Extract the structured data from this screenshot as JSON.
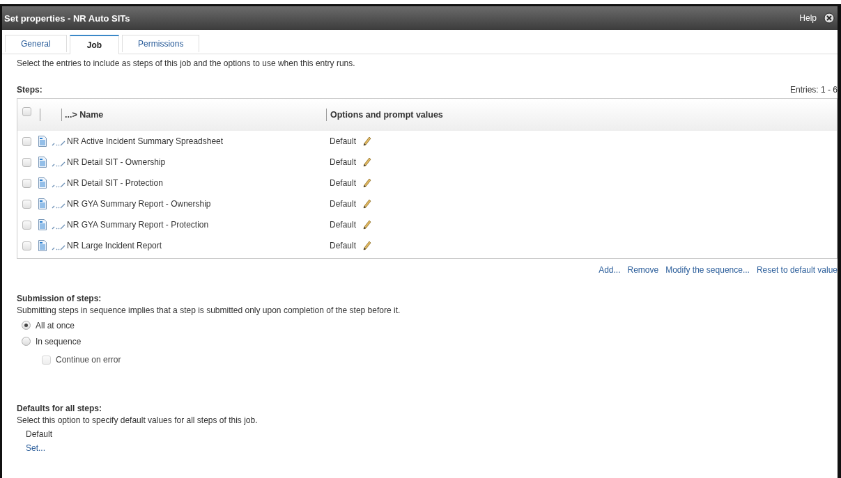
{
  "window": {
    "title": "Set properties - NR Auto SITs",
    "help": "Help"
  },
  "tabs": [
    {
      "label": "General",
      "selected": false
    },
    {
      "label": "Job",
      "selected": true
    },
    {
      "label": "Permissions",
      "selected": false
    }
  ],
  "description": "Select the entries to include as steps of this job and the options to use when this entry runs.",
  "steps": {
    "heading": "Steps:",
    "entries": "Entries: 1 - 6",
    "select_all_checked": false,
    "columns": [
      "...> Name",
      "Options and prompt values"
    ],
    "rows": [
      {
        "name": "NR Active Incident Summary Spreadsheet",
        "options": "Default",
        "checked": false
      },
      {
        "name": "NR Detail SIT - Ownership",
        "options": "Default",
        "checked": false
      },
      {
        "name": "NR Detail SIT - Protection",
        "options": "Default",
        "checked": false
      },
      {
        "name": "NR GYA Summary Report - Ownership",
        "options": "Default",
        "checked": false
      },
      {
        "name": "NR GYA Summary Report - Protection",
        "options": "Default",
        "checked": false
      },
      {
        "name": "NR Large Incident Report",
        "options": "Default",
        "checked": false
      }
    ],
    "actions": [
      "Add...",
      "Remove",
      "Modify the sequence...",
      "Reset to default value"
    ]
  },
  "submission": {
    "heading": "Submission of steps:",
    "description": "Submitting steps in sequence implies that a step is submitted only upon completion of the step before it.",
    "options": [
      {
        "label": "All at once",
        "selected": true
      },
      {
        "label": "In sequence",
        "selected": false
      }
    ],
    "continue_on_error": {
      "label": "Continue on error",
      "checked": false,
      "disabled": true
    }
  },
  "defaults": {
    "heading": "Defaults for all steps:",
    "description": "Select this option to specify default values for all steps of this job.",
    "value": "Default",
    "link": "Set..."
  }
}
